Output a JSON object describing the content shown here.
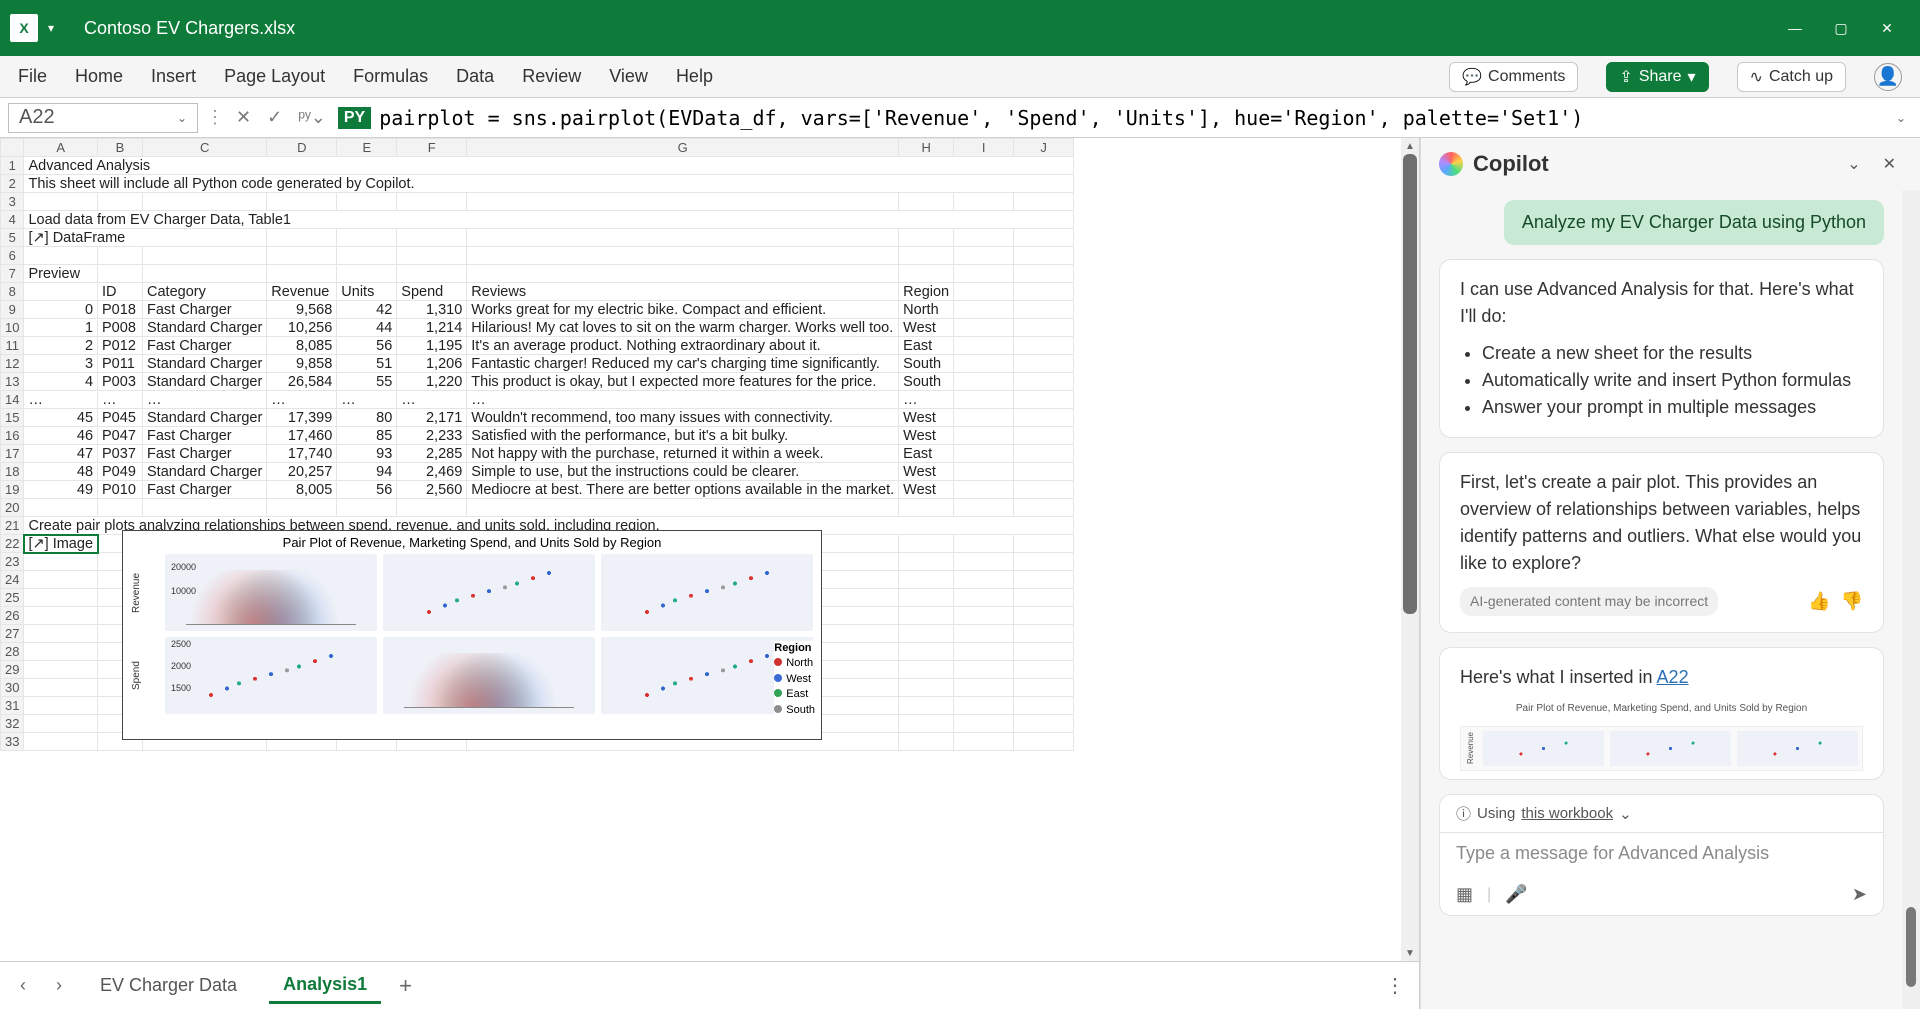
{
  "titlebar": {
    "app_abbrev": "X",
    "filename": "Contoso EV Chargers.xlsx"
  },
  "ribbon": {
    "tabs": [
      "File",
      "Home",
      "Insert",
      "Page Layout",
      "Formulas",
      "Data",
      "Review",
      "View",
      "Help"
    ],
    "comments": "Comments",
    "share": "Share",
    "catchup": "Catch up"
  },
  "formula_bar": {
    "name_box": "A22",
    "py_badge": "PY",
    "formula": "pairplot = sns.pairplot(EVData_df, vars=['Revenue', 'Spend', 'Units'], hue='Region', palette='Set1')"
  },
  "columns": [
    "A",
    "B",
    "C",
    "D",
    "E",
    "F",
    "G",
    "H",
    "I",
    "J"
  ],
  "sheet_content": {
    "r1": "Advanced Analysis",
    "r2": "This sheet will include all Python code generated by Copilot.",
    "r4": "Load data from EV Charger Data, Table1",
    "r5": "[↗] DataFrame",
    "r7": "Preview",
    "headers": {
      "idx": "",
      "id": "ID",
      "category": "Category",
      "revenue": "Revenue",
      "units": "Units",
      "spend": "Spend",
      "reviews": "Reviews",
      "region": "Region"
    },
    "data_top": [
      {
        "n": "0",
        "id": "P018",
        "cat": "Fast Charger",
        "rev": "9,568",
        "units": "42",
        "spend": "1,310",
        "review": "Works great for my electric bike. Compact and efficient.",
        "region": "North"
      },
      {
        "n": "1",
        "id": "P008",
        "cat": "Standard Charger",
        "rev": "10,256",
        "units": "44",
        "spend": "1,214",
        "review": "Hilarious! My cat loves to sit on the warm charger. Works well too.",
        "region": "West"
      },
      {
        "n": "2",
        "id": "P012",
        "cat": "Fast Charger",
        "rev": "8,085",
        "units": "56",
        "spend": "1,195",
        "review": "It's an average product. Nothing extraordinary about it.",
        "region": "East"
      },
      {
        "n": "3",
        "id": "P011",
        "cat": "Standard Charger",
        "rev": "9,858",
        "units": "51",
        "spend": "1,206",
        "review": "Fantastic charger! Reduced my car's charging time significantly.",
        "region": "South"
      },
      {
        "n": "4",
        "id": "P003",
        "cat": "Standard Charger",
        "rev": "26,584",
        "units": "55",
        "spend": "1,220",
        "review": "This product is okay, but I expected more features for the price.",
        "region": "South"
      }
    ],
    "ellipsis": "…",
    "data_bottom": [
      {
        "n": "45",
        "id": "P045",
        "cat": "Standard Charger",
        "rev": "17,399",
        "units": "80",
        "spend": "2,171",
        "review": "Wouldn't recommend, too many issues with connectivity.",
        "region": "West"
      },
      {
        "n": "46",
        "id": "P047",
        "cat": "Fast Charger",
        "rev": "17,460",
        "units": "85",
        "spend": "2,233",
        "review": "Satisfied with the performance, but it's a bit bulky.",
        "region": "West"
      },
      {
        "n": "47",
        "id": "P037",
        "cat": "Fast Charger",
        "rev": "17,740",
        "units": "93",
        "spend": "2,285",
        "review": "Not happy with the purchase, returned it within a week.",
        "region": "East"
      },
      {
        "n": "48",
        "id": "P049",
        "cat": "Standard Charger",
        "rev": "20,257",
        "units": "94",
        "spend": "2,469",
        "review": "Simple to use, but the instructions could be clearer.",
        "region": "West"
      },
      {
        "n": "49",
        "id": "P010",
        "cat": "Fast Charger",
        "rev": "8,005",
        "units": "56",
        "spend": "2,560",
        "review": "Mediocre at best. There are better options available in the market.",
        "region": "West"
      }
    ],
    "r21": "Create pair plots analyzing relationships between spend, revenue, and units sold, including region.",
    "r22": "[↗] Image"
  },
  "pairplot": {
    "title": "Pair Plot of Revenue, Marketing Spend, and Units Sold by Region",
    "ylabels": [
      "Revenue",
      "Spend"
    ],
    "rev_ticks": [
      "20000",
      "10000"
    ],
    "spend_ticks": [
      "2500",
      "2000",
      "1500"
    ],
    "legend_title": "Region",
    "legend": [
      "North",
      "West",
      "East",
      "South"
    ],
    "legend_colors": [
      "#d03131",
      "#3a6bd6",
      "#33a357",
      "#8e8e8e"
    ]
  },
  "sheet_tabs": {
    "tab1": "EV Charger Data",
    "tab2": "Analysis1"
  },
  "copilot": {
    "title": "Copilot",
    "user_msg": "Analyze my EV Charger Data using Python",
    "ai1_intro": "I can use Advanced Analysis for that. Here's what I'll do:",
    "ai1_bullets": [
      "Create a new sheet for the results",
      "Automatically write and insert Python formulas",
      "Answer your prompt in multiple messages"
    ],
    "ai2": "First, let's create a pair plot. This provides an overview of relationships between variables, helps identify patterns and outliers. What else would you like to explore?",
    "disclaimer": "AI-generated content may be incorrect",
    "ai3_prefix": "Here's what I inserted in ",
    "ai3_link": "A22",
    "thumb_title": "Pair Plot of Revenue, Marketing Spend, and Units Sold by Region",
    "using_prefix": "Using ",
    "using_link": "this workbook",
    "placeholder": "Type a message for Advanced Analysis"
  },
  "chart_data": {
    "type": "pairplot",
    "title": "Pair Plot of Revenue, Marketing Spend, and Units Sold by Region",
    "vars": [
      "Revenue",
      "Spend",
      "Units"
    ],
    "hue": "Region",
    "regions": [
      "North",
      "West",
      "East",
      "South"
    ],
    "axes_visible": {
      "Revenue": {
        "ticks": [
          10000,
          20000
        ]
      },
      "Spend": {
        "ticks": [
          1500,
          2000,
          2500
        ]
      }
    },
    "note": "Diagonal cells show KDE distributions per region; off-diagonal cells show scatter of variable pairs colored by Region. Only top two rows visible in screenshot."
  }
}
